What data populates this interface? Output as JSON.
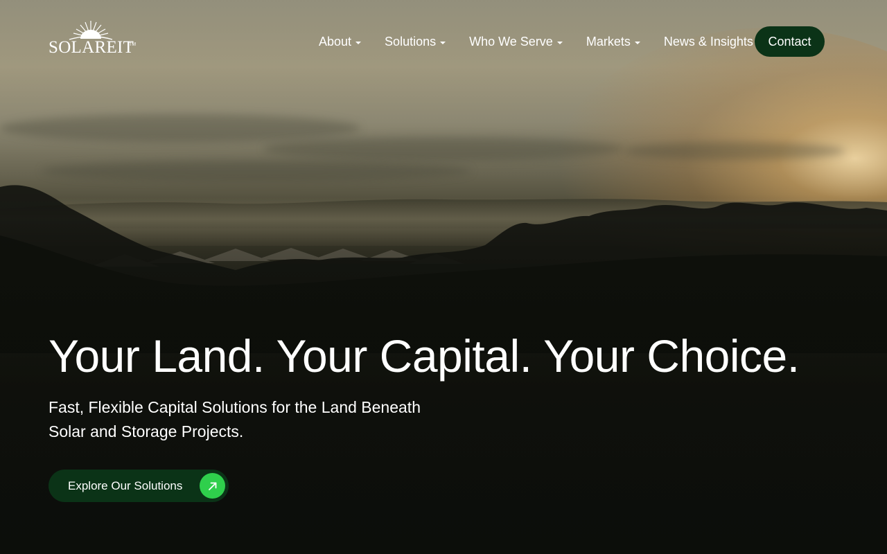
{
  "header": {
    "logo_text": "SOLAREIT",
    "logo_mark": "TM",
    "nav": [
      {
        "label": "About",
        "icon": "chevron-down-icon"
      },
      {
        "label": "Solutions",
        "icon": "chevron-down-icon"
      },
      {
        "label": "Who We Serve",
        "icon": "chevron-down-icon"
      },
      {
        "label": "Markets",
        "icon": "chevron-down-icon"
      },
      {
        "label": "News & Insights"
      }
    ],
    "contact_label": "Contact"
  },
  "hero": {
    "headline": "Your Land. Your Capital. Your Choice.",
    "subhead": "Fast, Flexible Capital Solutions for the Land Beneath Solar and Storage Projects.",
    "cta_label": "Explore Our Solutions",
    "cta_icon": "arrow-up-right-icon"
  },
  "colors": {
    "brand_dark_green": "#0b3317",
    "accent_green": "#2fcf4c",
    "text": "#ffffff"
  }
}
